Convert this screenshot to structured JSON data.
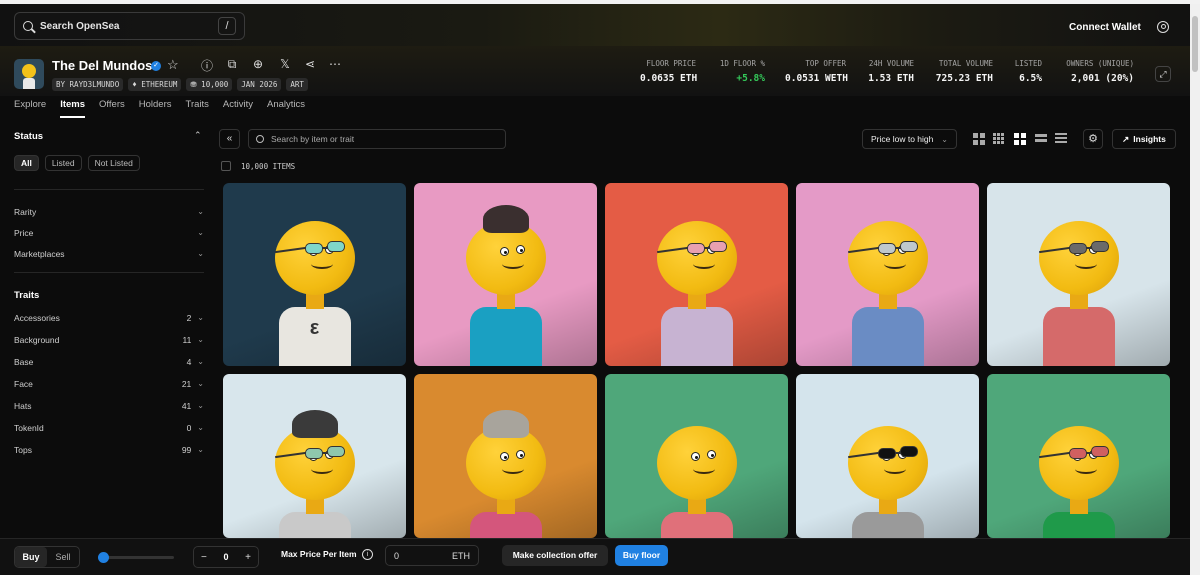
{
  "topbar": {
    "search_placeholder": "Search OpenSea",
    "shortcut": "/",
    "connect_label": "Connect Wallet"
  },
  "collection": {
    "name": "The Del Mundos",
    "chips": [
      "BY RAYD3LMUNDO",
      "♦ ETHEREUM",
      "⛃ 10,000",
      "JAN 2026",
      "ART"
    ],
    "stats": [
      {
        "label": "FLOOR PRICE",
        "value": "0.0635 ETH",
        "positive": false
      },
      {
        "label": "1D FLOOR %",
        "value": "+5.8%",
        "positive": true
      },
      {
        "label": "TOP OFFER",
        "value": "0.0531 WETH",
        "positive": false
      },
      {
        "label": "24H VOLUME",
        "value": "1.53 ETH",
        "positive": false
      },
      {
        "label": "TOTAL VOLUME",
        "value": "725.23 ETH",
        "positive": false
      },
      {
        "label": "LISTED",
        "value": "6.5%",
        "positive": false
      },
      {
        "label": "OWNERS (UNIQUE)",
        "value": "2,001 (20%)",
        "positive": false
      }
    ]
  },
  "tabs": [
    "Explore",
    "Items",
    "Offers",
    "Holders",
    "Traits",
    "Activity",
    "Analytics"
  ],
  "active_tab": "Items",
  "sidebar": {
    "status_title": "Status",
    "status_buttons": [
      "All",
      "Listed",
      "Not Listed"
    ],
    "filters": [
      "Rarity",
      "Price",
      "Marketplaces"
    ],
    "traits_title": "Traits",
    "traits": [
      {
        "name": "Accessories",
        "count": "2"
      },
      {
        "name": "Background",
        "count": "11"
      },
      {
        "name": "Base",
        "count": "4"
      },
      {
        "name": "Face",
        "count": "21"
      },
      {
        "name": "Hats",
        "count": "41"
      },
      {
        "name": "TokenId",
        "count": "0"
      },
      {
        "name": "Tops",
        "count": "99"
      }
    ]
  },
  "toolbar": {
    "search_placeholder": "Search by item or trait",
    "sort_label": "Price low to high",
    "insights_label": "Insights",
    "items_count": "10,000 ITEMS"
  },
  "items": [
    {
      "bg": "#1f3a4c",
      "shirt": "#e8e6e0",
      "glasses": "#7fd6c8",
      "hat": "none",
      "mark": "ε"
    },
    {
      "bg": "#e89ac3",
      "shirt": "#1aa0c2",
      "glasses": "none",
      "hat": "#3a2f2f",
      "mark": ""
    },
    {
      "bg": "#e45c45",
      "shirt": "#c7b3d2",
      "glasses": "#e8a0b0",
      "hat": "none",
      "mark": ""
    },
    {
      "bg": "#e49ac7",
      "shirt": "#6a8cc4",
      "glasses": "#bfc8cc",
      "hat": "none",
      "mark": ""
    },
    {
      "bg": "#d7e4ea",
      "shirt": "#d56a6a",
      "glasses": "#6a6a6a",
      "hat": "none",
      "mark": ""
    },
    {
      "bg": "#d8e6ec",
      "shirt": "#c9c9c9",
      "glasses": "#8fc7ad",
      "hat": "#3a3a3a",
      "mark": ""
    },
    {
      "bg": "#d98a2f",
      "shirt": "#d4567c",
      "glasses": "none",
      "hat": "#a8a49c",
      "mark": ""
    },
    {
      "bg": "#4fa77a",
      "shirt": "#e0707a",
      "glasses": "none",
      "hat": "none",
      "mark": ""
    },
    {
      "bg": "#d4e4ec",
      "shirt": "#9a9a9a",
      "glasses": "#111111",
      "hat": "none",
      "mark": ""
    },
    {
      "bg": "#4fa77a",
      "shirt": "#1f9a4a",
      "glasses": "#d06060",
      "hat": "none",
      "mark": ""
    }
  ],
  "bottom": {
    "buy_label": "Buy",
    "sell_label": "Sell",
    "quantity": "0",
    "max_price_label": "Max Price Per Item",
    "price_value": "0",
    "price_unit": "ETH",
    "offer_label": "Make collection offer",
    "floor_label": "Buy floor"
  }
}
